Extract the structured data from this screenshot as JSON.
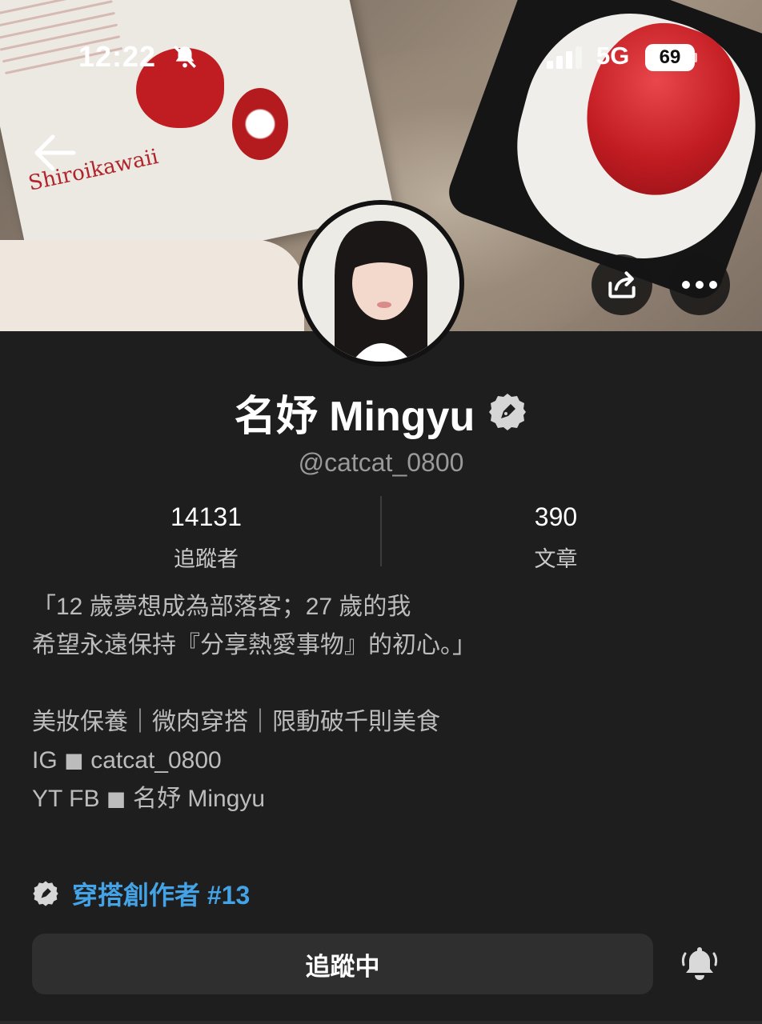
{
  "status_bar": {
    "time": "12:22",
    "network": "5G",
    "battery": "69"
  },
  "cover": {
    "brand_text": "Shiroikawaii"
  },
  "profile": {
    "name": "名妤 Mingyu",
    "handle": "@catcat_0800",
    "stats": [
      {
        "value": "14131",
        "label": "追蹤者"
      },
      {
        "value": "390",
        "label": "文章"
      }
    ],
    "bio_lines": [
      "「12 歲夢想成為部落客；27 歲的我",
      "希望永遠保持『分享熱愛事物』的初心。」",
      "",
      "美妝保養｜微肉穿搭｜限動破千則美食",
      "IG ◼︎ catcat_0800",
      "YT FB ◼︎ 名妤 Mingyu"
    ],
    "category": "穿搭創作者 #13",
    "follow_label": "追蹤中"
  },
  "colors": {
    "background": "#1e1e1e",
    "accent_blue": "#44a3e6",
    "button_bg": "#2f2f2f",
    "muted_text": "#9a9a9a"
  },
  "icons": [
    "bell-off-icon",
    "signal-icon",
    "back-arrow-icon",
    "share-icon",
    "more-icon",
    "verified-pen-icon",
    "notification-bell-icon"
  ]
}
